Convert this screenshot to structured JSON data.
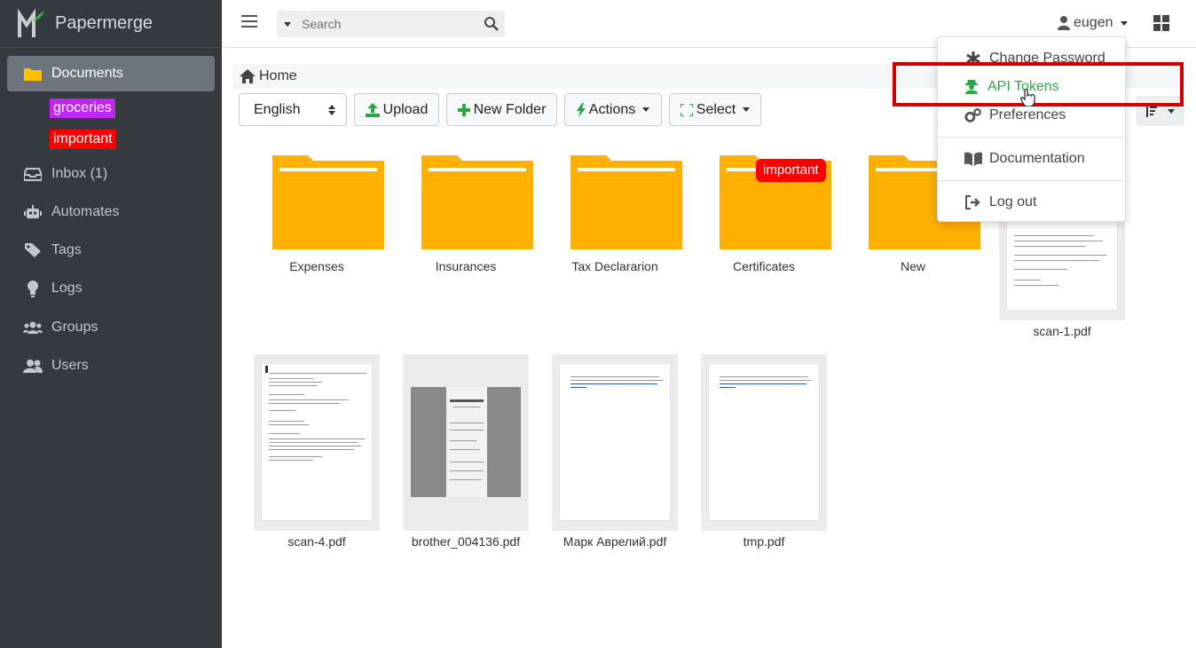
{
  "app": {
    "name": "Papermerge"
  },
  "sidebar": {
    "items": [
      {
        "label": "Documents",
        "icon": "folder-icon"
      },
      {
        "label": "Inbox (1)",
        "icon": "inbox-icon"
      },
      {
        "label": "Automates",
        "icon": "robot-icon"
      },
      {
        "label": "Tags",
        "icon": "tag-icon"
      },
      {
        "label": "Logs",
        "icon": "lightbulb-icon"
      },
      {
        "label": "Groups",
        "icon": "users-group-icon"
      },
      {
        "label": "Users",
        "icon": "user-friends-icon"
      }
    ],
    "tags": [
      {
        "label": "groceries",
        "color": "#c026f0"
      },
      {
        "label": "important",
        "color": "#ff0000"
      }
    ]
  },
  "topbar": {
    "search_placeholder": "Search",
    "user": "eugen"
  },
  "breadcrumb": {
    "home": "Home"
  },
  "toolbar": {
    "language": "English",
    "upload": "Upload",
    "new_folder": "New Folder",
    "actions": "Actions",
    "select": "Select"
  },
  "folders": [
    {
      "name": "Expenses"
    },
    {
      "name": "Insurances"
    },
    {
      "name": "Tax Declararion"
    },
    {
      "name": "Certificates",
      "tag": "important"
    },
    {
      "name": "New"
    }
  ],
  "documents": [
    {
      "name": "scan-1.pdf"
    },
    {
      "name": "scan-4.pdf"
    },
    {
      "name": "brother_004136.pdf"
    },
    {
      "name": "Марк Аврелий.pdf"
    },
    {
      "name": "tmp.pdf"
    }
  ],
  "user_menu": {
    "items": [
      {
        "label": "Change Password",
        "icon": "asterisk-icon"
      },
      {
        "label": "API Tokens",
        "icon": "user-secret-icon"
      },
      {
        "label": "Preferences",
        "icon": "gears-icon"
      },
      {
        "label": "Documentation",
        "icon": "book-icon"
      },
      {
        "label": "Log out",
        "icon": "sign-out-icon"
      }
    ]
  },
  "colors": {
    "sidebar_bg": "#343a40",
    "folder": "#ffb000",
    "accent_green": "#28a745",
    "highlight": "#d10000"
  }
}
